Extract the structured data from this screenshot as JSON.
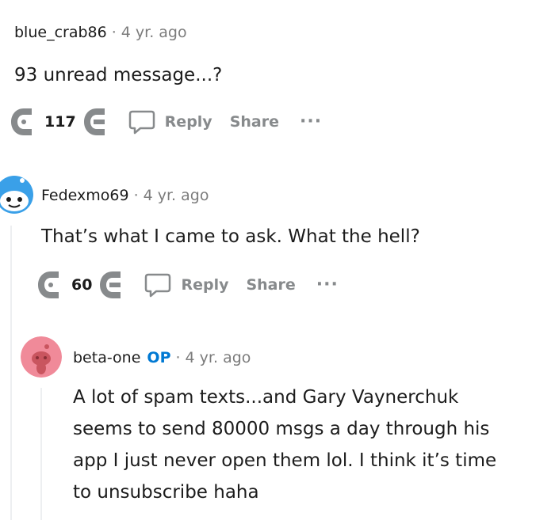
{
  "comments": [
    {
      "username": "blue_crab86",
      "separator": "·",
      "time": "4 yr. ago",
      "body": "93 unread message...?",
      "score": "117",
      "reply_label": "Reply",
      "share_label": "Share",
      "more_label": "···"
    },
    {
      "username": "Fedexmo69",
      "separator": "·",
      "time": "4 yr. ago",
      "body": "That’s what I came to ask. What the hell?",
      "score": "60",
      "reply_label": "Reply",
      "share_label": "Share",
      "more_label": "···"
    },
    {
      "username": "beta-one",
      "op_badge": "OP",
      "separator": "·",
      "time": "4 yr. ago",
      "body_lines": [
        "A lot of spam texts...and Gary Vaynerchuk",
        "seems to send 80000 msgs a day through his",
        "app I just never open them lol. I think it’s time",
        "to unsubscribe haha"
      ]
    }
  ],
  "icons": {
    "upvote": "upvote-arrow-icon",
    "downvote": "downvote-arrow-icon",
    "reply": "speech-bubble-icon",
    "avatar_user": "reddit-snoo-avatar",
    "avatar_op": "reddit-snoo-avatar-pink"
  },
  "colors": {
    "op": "#0079d3",
    "meta_gray": "#7c7c7c",
    "action_gray": "#878a8c",
    "vote_icon": "#878a8c",
    "avatar_blue": "#3aa0e8",
    "avatar_pink": "#f08a99"
  }
}
